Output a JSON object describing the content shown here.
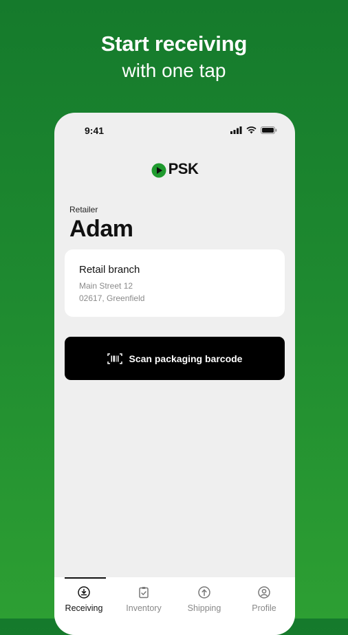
{
  "headline": {
    "line1": "Start receiving",
    "line2": "with one tap"
  },
  "status_bar": {
    "time": "9:41"
  },
  "logo": {
    "text": "PSK",
    "brand_color": "#1f9a2e"
  },
  "user": {
    "role_label": "Retailer",
    "name": "Adam"
  },
  "branch": {
    "title": "Retail branch",
    "address_line1": "Main Street 12",
    "address_line2": "02617, Greenfield"
  },
  "scan_button": {
    "label": "Scan packaging barcode",
    "icon": "barcode-scan-icon"
  },
  "tabs": [
    {
      "label": "Receiving",
      "icon": "receiving-icon",
      "active": true
    },
    {
      "label": "Inventory",
      "icon": "clipboard-icon",
      "active": false
    },
    {
      "label": "Shipping",
      "icon": "upload-icon",
      "active": false
    },
    {
      "label": "Profile",
      "icon": "user-icon",
      "active": false
    }
  ]
}
